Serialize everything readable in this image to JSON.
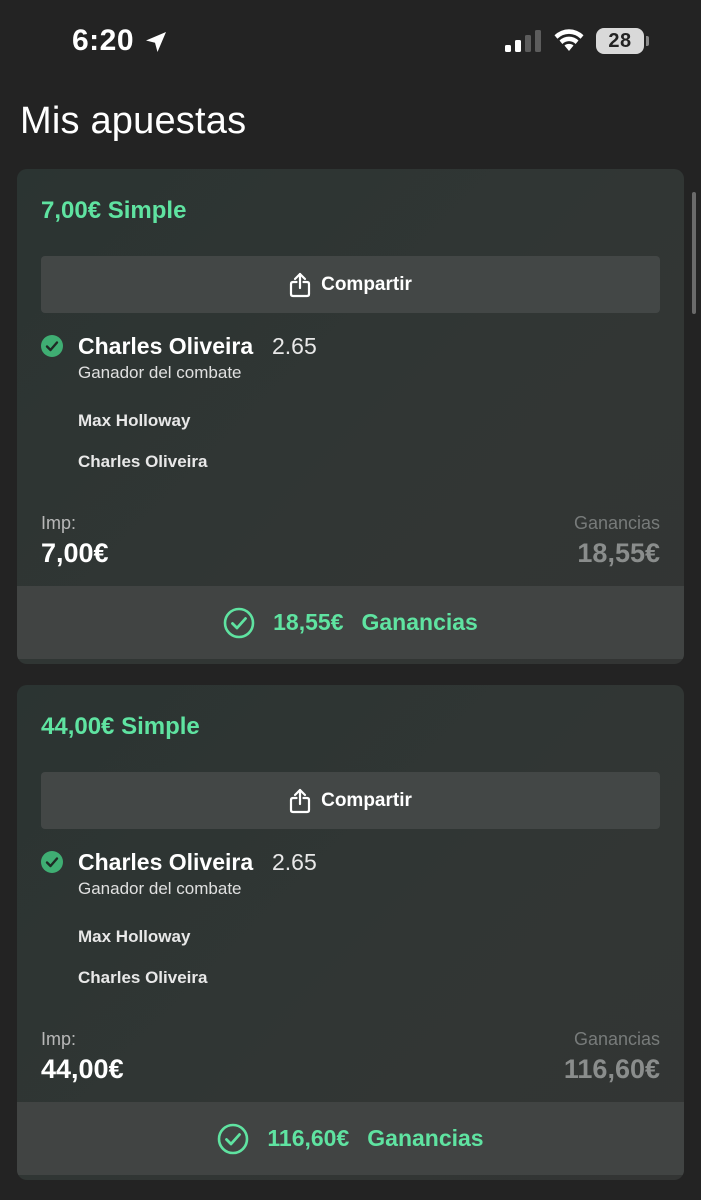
{
  "status_bar": {
    "time": "6:20",
    "battery": "28"
  },
  "page": {
    "title": "Mis apuestas"
  },
  "colors": {
    "accent_green": "#5fe3a1",
    "check_green": "#3fae73",
    "background": "#232323"
  },
  "icons": {
    "location": "location-arrow-icon",
    "signal": "cellular-signal-icon",
    "wifi": "wifi-icon",
    "share": "share-icon",
    "check": "check-circle-icon"
  },
  "bets": [
    {
      "heading": "7,00€ Simple",
      "share_label": "Compartir",
      "selection": {
        "name": "Charles Oliveira",
        "odds": "2.65",
        "market": "Ganador del combate"
      },
      "participants": [
        "Max Holloway",
        "Charles Oliveira"
      ],
      "stake_label": "Imp:",
      "stake_value": "7,00€",
      "winnings_label": "Ganancias",
      "winnings_value": "18,55€",
      "result_amount": "18,55€",
      "result_label": "Ganancias"
    },
    {
      "heading": "44,00€ Simple",
      "share_label": "Compartir",
      "selection": {
        "name": "Charles Oliveira",
        "odds": "2.65",
        "market": "Ganador del combate"
      },
      "participants": [
        "Max Holloway",
        "Charles Oliveira"
      ],
      "stake_label": "Imp:",
      "stake_value": "44,00€",
      "winnings_label": "Ganancias",
      "winnings_value": "116,60€",
      "result_amount": "116,60€",
      "result_label": "Ganancias"
    }
  ]
}
